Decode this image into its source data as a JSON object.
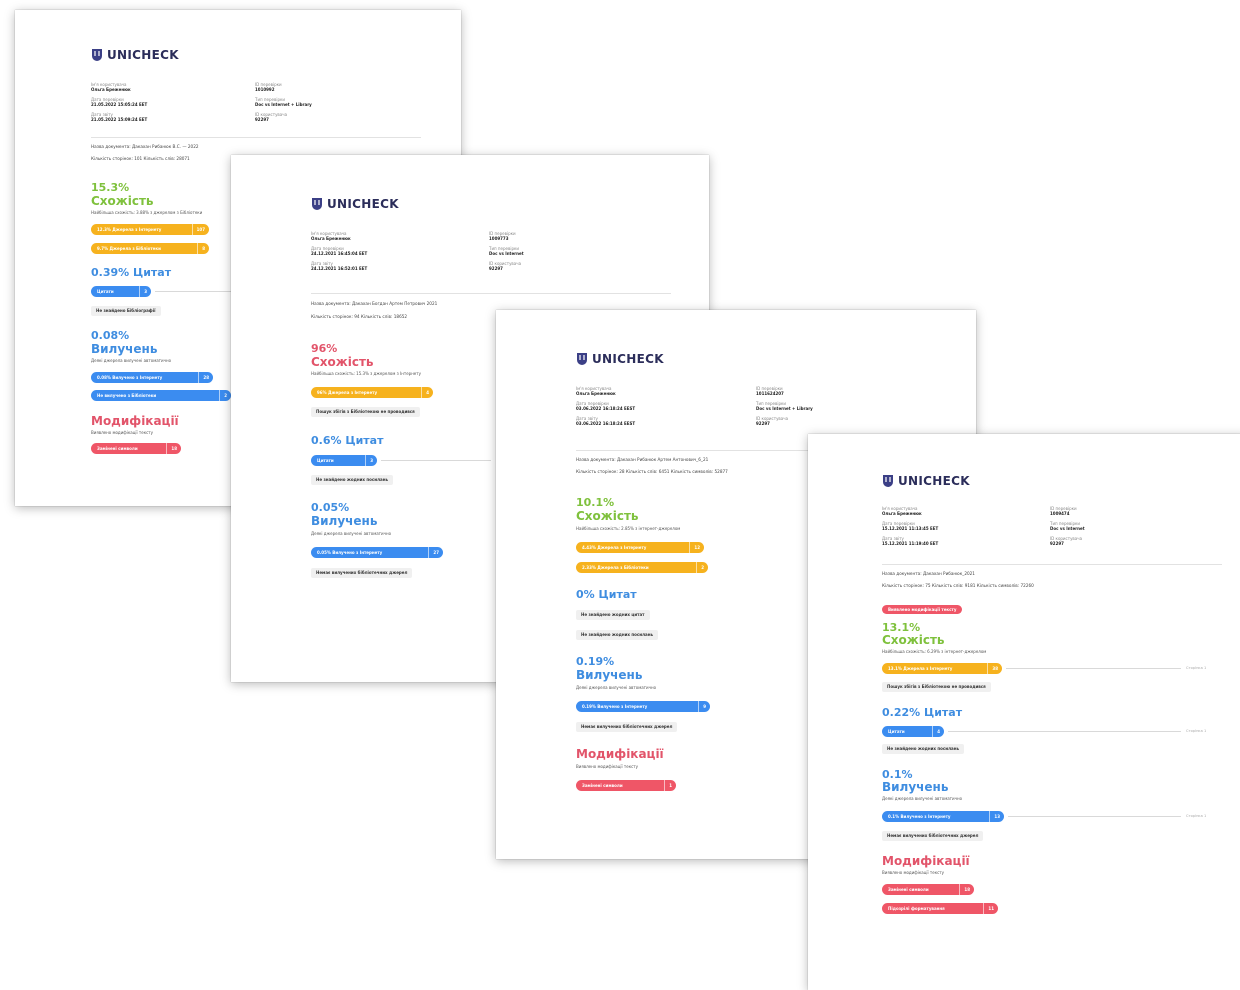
{
  "brand": "UNICHECK",
  "pages": [
    {
      "id": "p1",
      "meta": [
        {
          "label": "Ім'я користувача",
          "value": "Ольга Бреженюк"
        },
        {
          "label": "ID перевірки",
          "value": "1010992"
        },
        {
          "label": "Дата перевірки",
          "value": "21.05.2022 15:05:24 EET"
        },
        {
          "label": "Тип перевірки",
          "value": "Doc vs Internet + Library"
        },
        {
          "label": "Дата звіту",
          "value": "21.05.2022 15:09:24 EET"
        },
        {
          "label": "ID користувача",
          "value": "92297"
        }
      ],
      "doc_line": "Назва документа: Дакахан Рибанюк В.С. — 2022",
      "stats_line": "Кількість сторінок: 101  Кількість слів: 28071",
      "similarity": {
        "pct": "15.3%",
        "label": "Схожість",
        "sub": "Найбільша схожість: 3.88% з джерелом з Бібліотеки"
      },
      "sim_pills": [
        {
          "text": "12.3% Джерела з Інтернету",
          "count": "107"
        },
        {
          "text": "9.7% Джерела з Бібліотеки",
          "count": "8"
        }
      ],
      "citations": {
        "pct": "0.39%",
        "label": "Цитат",
        "pill": "Цитати",
        "count": "3"
      },
      "citation_tag": "Не знайдено Бібліографії",
      "exclusions": {
        "pct": "0.08%",
        "label": "Вилучень",
        "sub": "Деякі джерела вилучені автоматично"
      },
      "excl_pills": [
        {
          "text": "0.08% Вилучено з Інтернету",
          "count": "28"
        },
        {
          "text": "Не вилучено з Бібліотеки",
          "count": "2"
        }
      ],
      "modifications": {
        "label": "Модифікації",
        "sub": "Виявлено модифікації тексту",
        "pill": "Замінені символи",
        "count": "18"
      }
    },
    {
      "id": "p2",
      "meta": [
        {
          "label": "Ім'я користувача",
          "value": "Ольга Бреженюк"
        },
        {
          "label": "ID перевірки",
          "value": "1009773"
        },
        {
          "label": "Дата перевірки",
          "value": "24.12.2021 16:45:04 EET"
        },
        {
          "label": "Тип перевірки",
          "value": "Doc vs Internet"
        },
        {
          "label": "Дата звіту",
          "value": "24.12.2021 16:52:01 EET"
        },
        {
          "label": "ID користувача",
          "value": "92297"
        }
      ],
      "doc_line": "Назва документа: Дакахан Богдан Артем Петрович 2021",
      "stats_line": "Кількість сторінок: 94  Кількість слів: 18652",
      "similarity": {
        "pct": "96%",
        "label": "Схожість",
        "sub": "Найбільша схожість: 15.3% з джерелом з Інтернету"
      },
      "sim_pills": [
        {
          "text": "96% Джерела з Інтернету",
          "count": "4"
        }
      ],
      "sim_tag": "Пошук збігів з Бібліотекою не проводився",
      "citations": {
        "pct": "0.6%",
        "label": "Цитат",
        "pill": "Цитати",
        "count": "3"
      },
      "citation_tag": "Не знайдено жодних посилань",
      "exclusions": {
        "pct": "0.05%",
        "label": "Вилучень",
        "sub": "Деякі джерела вилучені автоматично"
      },
      "excl_pills": [
        {
          "text": "0.05% Вилучено з Інтернету",
          "count": "27"
        }
      ],
      "excl_tag": "Немає вилучених бібліотечних джерел"
    },
    {
      "id": "p3",
      "meta": [
        {
          "label": "Ім'я користувача",
          "value": "Ольга Бреженюк"
        },
        {
          "label": "ID перевірки",
          "value": "1011624207"
        },
        {
          "label": "Дата перевірки",
          "value": "03.06.2022 16:18:24 EEST"
        },
        {
          "label": "Тип перевірки",
          "value": "Doc vs Internet + Library"
        },
        {
          "label": "Дата звіту",
          "value": "03.06.2022 16:18:24 EEST"
        },
        {
          "label": "ID користувача",
          "value": "92297"
        }
      ],
      "doc_line": "Назва документа: Дакахан Рибанюк Артем Антонович_6_21",
      "stats_line": "Кількість сторінок: 28  Кількість слів: 6451  Кількість символів: 52877",
      "similarity": {
        "pct": "10.1%",
        "label": "Схожість",
        "sub": "Найбільша схожість: 2.85% з інтернет-джерелом"
      },
      "sim_pills": [
        {
          "text": "4.43% Джерела з Інтернету",
          "count": "12"
        },
        {
          "text": "2.33% Джерела з Бібліотеки",
          "count": "2"
        }
      ],
      "citations": {
        "pct": "0%",
        "label": "Цитат"
      },
      "citation_tags": [
        "Не знайдено жодних цитат",
        "Не знайдено жодних посилань"
      ],
      "exclusions": {
        "pct": "0.19%",
        "label": "Вилучень",
        "sub": "Деякі джерела вилучені автоматично"
      },
      "excl_pills": [
        {
          "text": "0.19% Вилучено з Інтернету",
          "count": "9"
        }
      ],
      "excl_tag": "Немає вилучених бібліотечних джерел",
      "modifications": {
        "label": "Модифікації",
        "sub": "Виявлено модифікації тексту",
        "pill": "Замінені символи",
        "count": "1"
      }
    },
    {
      "id": "p4",
      "meta": [
        {
          "label": "Ім'я користувача",
          "value": "Ольга Бреженюк"
        },
        {
          "label": "ID перевірки",
          "value": "1009474"
        },
        {
          "label": "Дата перевірки",
          "value": "15.12.2021 11:13:45 EET"
        },
        {
          "label": "Тип перевірки",
          "value": "Doc vs Internet"
        },
        {
          "label": "Дата звіту",
          "value": "15.12.2021 11:19:40 EET"
        },
        {
          "label": "ID користувача",
          "value": "92297"
        }
      ],
      "doc_line": "Назва документа: Дакахан Рибанюк_2021",
      "stats_line": "Кількість сторінок: 75  Кількість слів: 9181  Кількість символів: 72260",
      "warning": "Виявлено модифікації тексту",
      "similarity": {
        "pct": "13.1%",
        "label": "Схожість",
        "sub": "Найбільша схожість: 6.29% з інтернет-джерелом"
      },
      "sim_pills": [
        {
          "text": "13.1% Джерела з Інтернету",
          "count": "38"
        }
      ],
      "sim_tag": "Пошук збігів з Бібліотекою не проводився",
      "citations": {
        "pct": "0.22%",
        "label": "Цитат",
        "pill": "Цитати",
        "count": "4"
      },
      "citation_tag": "Не знайдено жодних посилань",
      "exclusions": {
        "pct": "0.1%",
        "label": "Вилучень",
        "sub": "Деякі джерела вилучені автоматично"
      },
      "excl_pills": [
        {
          "text": "0.1% Вилучено з Інтернету",
          "count": "13"
        }
      ],
      "excl_tag": "Немає вилучених бібліотечних джерел",
      "modifications": {
        "label": "Модифікації",
        "sub": "Виявлено модифікації тексту",
        "pill": "Замінені символи",
        "count": "18"
      },
      "mod_pill2": {
        "text": "Підозрілі форматування",
        "count": "11"
      },
      "side_note": "Сторінка 1"
    }
  ]
}
